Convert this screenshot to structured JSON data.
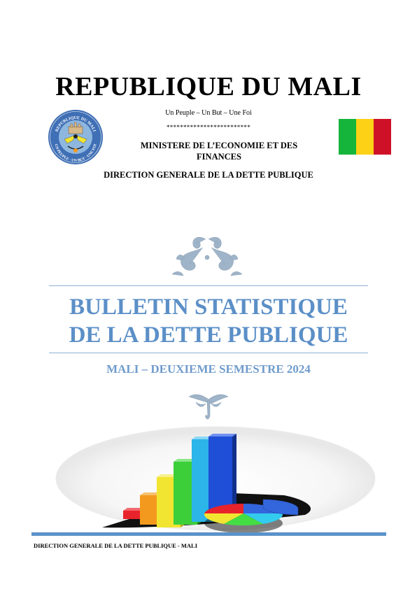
{
  "header": {
    "title": "REPUBLIQUE DU MALI",
    "motto": "Un Peuple – Un But – Une Foi",
    "stars": "*************************",
    "ministry": "MINISTERE DE L’ECONOMIE ET DES FINANCES",
    "direction": "DIRECTION GENERALE DE LA DETTE PUBLIQUE"
  },
  "seal": {
    "icon": "mali-coat-of-arms-icon",
    "ring_text_top": "REPUBLIQUE DU MALI",
    "ring_text_bottom": "UN PEUPLE · UN BUT · UNE FOI"
  },
  "flag": {
    "icon": "mali-flag-icon",
    "colors": [
      "#14b53a",
      "#fcd116",
      "#ce1126"
    ]
  },
  "cover": {
    "title_line1": "BULLETIN STATISTIQUE",
    "title_line2": "DE LA DETTE PUBLIQUE",
    "subtitle": "MALI – DEUXIEME SEMESTRE 2024",
    "accent_color": "#5b8fc7",
    "ornament_icons": [
      "floral-ornament-icon",
      "floral-drop-ornament-icon"
    ]
  },
  "illustration": {
    "icon": "bar-and-pie-chart-illustration-icon",
    "bar_colors": [
      "#e8232b",
      "#f39a1e",
      "#f2e531",
      "#3ccf3a",
      "#2bb5e8",
      "#1f4fd6"
    ],
    "pie_colors": [
      "#3366dd",
      "#33ccee",
      "#44dd44",
      "#f2e531",
      "#e8232b"
    ]
  },
  "footer": {
    "text": "DIRECTION GENERALE DE LA DETTE PUBLIQUE - MALI",
    "bar_color": "#5b93c9"
  }
}
